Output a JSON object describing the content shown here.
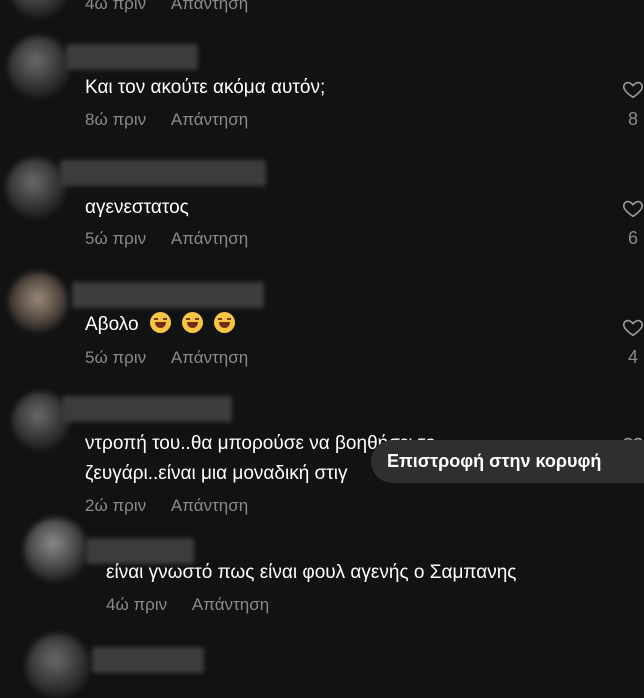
{
  "comments": [
    {
      "text": "",
      "time": "4ώ πριν",
      "reply": "Απάντηση",
      "likes": ""
    },
    {
      "text": "Και τον ακούτε ακόμα αυτόν;",
      "time": "8ώ πριν",
      "reply": "Απάντηση",
      "likes": "8"
    },
    {
      "text": "αγενεστατος",
      "time": "5ώ πριν",
      "reply": "Απάντηση",
      "likes": "6"
    },
    {
      "text": "Αβολο",
      "time": "5ώ πριν",
      "reply": "Απάντηση",
      "likes": "4"
    },
    {
      "text_line1": "ντροπή του..θα μπορούσε να βοηθήσει το",
      "text_line2": "ζευγάρι..είναι μια μοναδική στιγ",
      "time": "2ώ πριν",
      "reply": "Απάντηση"
    },
    {
      "text": "είναι γνωστό πως είναι φουλ αγενής ο Σαμπανης",
      "time": "4ώ πριν",
      "reply": "Απάντηση"
    }
  ],
  "emoji_names": [
    "laughing-tears-emoji",
    "laughing-tears-emoji",
    "laughing-tears-emoji"
  ],
  "tooltip": {
    "label": "Επιστροφή στην κορυφή"
  },
  "colors": {
    "background": "#121212",
    "text": "#ffffff",
    "meta": "#8a8a8a",
    "tooltip_bg": "#2f2f2f"
  }
}
